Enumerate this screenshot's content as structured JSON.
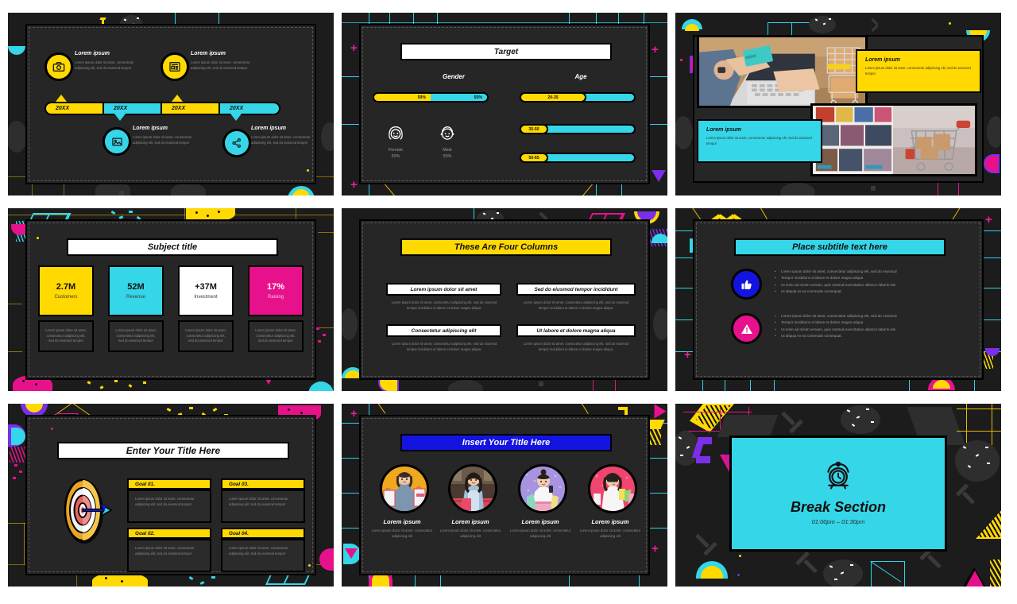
{
  "palette": {
    "yellow": "#FFD900",
    "cyan": "#35D6E8",
    "magenta": "#E8118C",
    "blue": "#1414E0",
    "purple": "#7B2FE8",
    "dark": "#1c1c1c",
    "panel": "#262626",
    "white": "#FFFFFF"
  },
  "lorem": {
    "short": "Lorem ipsum dolor sit amet, consectetur adipiscing elit, sed do eiusmod tempor",
    "medium": "Lorem ipsum dolor sit amet, consectetur adipiscing elit, sed do eiusmod tempor incididunt ut labore et dolore magna aliqua.",
    "tiny": "Lorem ipsum dolor sit amet, consectetur adipiscing elit"
  },
  "slides": [
    {
      "id": "timeline",
      "items": [
        {
          "title": "Lorem ipsum",
          "body": "Lorem ipsum dolor sit amet, consectetur adipiscing elit, sed do eiusmod tempor",
          "icon": "camera-icon",
          "color": "#FFD900"
        },
        {
          "title": "Lorem ipsum",
          "body": "Lorem ipsum dolor sit amet, consectetur adipiscing elit, sed do eiusmod tempor",
          "icon": "news-icon",
          "color": "#FFD900"
        },
        {
          "title": "Lorem ipsum",
          "body": "Lorem ipsum dolor sit amet, consectetur adipiscing elit, sed do eiusmod tempor",
          "icon": "image-icon",
          "color": "#35D6E8"
        },
        {
          "title": "Lorem ipsum",
          "body": "Lorem ipsum dolor sit amet, consectetur adipiscing elit, sed do eiusmod tempor",
          "icon": "share-icon",
          "color": "#35D6E8"
        }
      ],
      "segments": [
        {
          "label": "20XX",
          "color": "#FFD900"
        },
        {
          "label": "20XX",
          "color": "#35D6E8"
        },
        {
          "label": "20XX",
          "color": "#FFD900"
        },
        {
          "label": "20XX",
          "color": "#35D6E8"
        }
      ]
    },
    {
      "id": "target",
      "title": "Target",
      "gender_heading": "Gender",
      "age_heading": "Age",
      "gender": [
        {
          "label": "Female",
          "value": "50%",
          "percent": 50,
          "color": "#FFD900",
          "icon": "female-face-icon"
        },
        {
          "label": "Male",
          "value": "50%",
          "percent": 50,
          "color": "#35D6E8",
          "icon": "male-face-icon"
        }
      ],
      "age": [
        {
          "label": "20-35",
          "percent": 58
        },
        {
          "label": "35-50",
          "percent": 22
        },
        {
          "label": "50-65",
          "percent": 22
        }
      ]
    },
    {
      "id": "photos-two-up",
      "cards": [
        {
          "title": "Lorem ipsum",
          "body": "Lorem ipsum dolor sit amet, consectetur adipiscing elit, sed do eiusmod tempor",
          "color": "#FFD900"
        },
        {
          "title": "Lorem ipsum",
          "body": "Lorem ipsum dolor sit amet, consectetur adipiscing elit, sed do eiusmod tempor",
          "color": "#35D6E8"
        }
      ],
      "photos": [
        {
          "alt": "hands-holding-credit-card-at-laptop-photo"
        },
        {
          "alt": "shopping-cart-on-catalog-photo"
        }
      ]
    },
    {
      "id": "stats",
      "title": "Subject title",
      "kpis": [
        {
          "value": "2.7M",
          "label": "Customers",
          "color": "#FFD900",
          "note": "Lorem ipsum dolor sit amet, consectetur adipiscing elit, sed do eiusmod tempor"
        },
        {
          "value": "52M",
          "label": "Revenue",
          "color": "#35D6E8",
          "note": "Lorem ipsum dolor sit amet, consectetur adipiscing elit, sed do eiusmod tempor"
        },
        {
          "value": "+37M",
          "label": "Investment",
          "color": "#FFFFFF",
          "note": "Lorem ipsum dolor sit amet, consectetur adipiscing elit, sed do eiusmod tempor"
        },
        {
          "value": "17%",
          "label": "Raising",
          "color": "#E8118C",
          "note": "Lorem ipsum dolor sit amet, consectetur adipiscing elit, sed do eiusmod tempor"
        }
      ]
    },
    {
      "id": "four-columns",
      "title": "These Are Four Columns",
      "columns": [
        {
          "heading": "Lorem ipsum dolor sit amet",
          "body": "Lorem ipsum dolor sit amet, consectetur adipiscing elit, sed do eiusmod tempor incididunt ut labore et dolore magna aliqua."
        },
        {
          "heading": "Sed do eiusmod tempor incididunt",
          "body": "Lorem ipsum dolor sit amet, consectetur adipiscing elit, sed do eiusmod tempor incididunt ut labore et dolore magna aliqua."
        },
        {
          "heading": "Consectetur adipiscing elit",
          "body": "Lorem ipsum dolor sit amet, consectetur adipiscing elit, sed do eiusmod tempor incididunt ut labore et dolore magna aliqua."
        },
        {
          "heading": "Ut labore et dolore magna aliqua",
          "body": "Lorem ipsum dolor sit amet, consectetur adipiscing elit, sed do eiusmod tempor incididunt ut labore et dolore magna aliqua."
        }
      ]
    },
    {
      "id": "subtitle-bullets",
      "title": "Place subtitle text here",
      "groups": [
        {
          "icon": "thumbs-up-icon",
          "color": "#1414E0",
          "bullets": [
            "Lorem ipsum dolor sit amet, consectetur adipiscing elit, sed do eiusmod",
            "Tempor incididunt ut labore et dolore magna aliqua",
            "Ut enim ad minim veniam, quis nostrud exercitation ullamco laboris nisi",
            "Ut aliquip ex ea commodo consequat."
          ]
        },
        {
          "icon": "warning-icon",
          "color": "#E8118C",
          "bullets": [
            "Lorem ipsum dolor sit amet, consectetur adipiscing elit, sed do eiusmod",
            "Tempor incididunt ut labore et dolore magna aliqua",
            "Ut enim ad minim veniam, quis nostrud exercitation ullamco laboris nisi",
            "Ut aliquip ex ea commodo consequat."
          ]
        }
      ]
    },
    {
      "id": "goals",
      "title": "Enter Your Title Here",
      "illustration": "dartboard-with-dart-icon",
      "goals": [
        {
          "heading": "Goal 01.",
          "body": "Lorem ipsum dolor sit amet, consectetur adipiscing elit, sed do eiusmod tempor"
        },
        {
          "heading": "Goal 02.",
          "body": "Lorem ipsum dolor sit amet, consectetur adipiscing elit, sed do eiusmod tempor"
        },
        {
          "heading": "Goal 03.",
          "body": "Lorem ipsum dolor sit amet, consectetur adipiscing elit, sed do eiusmod tempor"
        },
        {
          "heading": "Goal 04.",
          "body": "Lorem ipsum dolor sit amet, consectetur adipiscing elit, sed do eiusmod tempor"
        }
      ]
    },
    {
      "id": "team-photos",
      "title": "Insert Your Title Here",
      "people": [
        {
          "name": "Lorem ipsum",
          "body": "Lorem ipsum dolor sit amet, consectetur adipiscing elit",
          "bg": "#F0A81E",
          "alt": "woman-with-shopping-bags-photo"
        },
        {
          "name": "Lorem ipsum",
          "body": "Lorem ipsum dolor sit amet, consectetur adipiscing elit",
          "bg": "#4A3A32",
          "alt": "woman-shopping-in-store-photo"
        },
        {
          "name": "Lorem ipsum",
          "body": "Lorem ipsum dolor sit amet, consectetur adipiscing elit",
          "bg": "#A893E0",
          "alt": "woman-with-phone-photo"
        },
        {
          "name": "Lorem ipsum",
          "body": "Lorem ipsum dolor sit amet, consectetur adipiscing elit",
          "bg": "#F0456E",
          "alt": "woman-in-sunglasses-with-bags-photo"
        }
      ]
    },
    {
      "id": "break",
      "icon": "alarm-clock-icon",
      "title": "Break Section",
      "time": "01:00pm – 01:30pm"
    }
  ]
}
